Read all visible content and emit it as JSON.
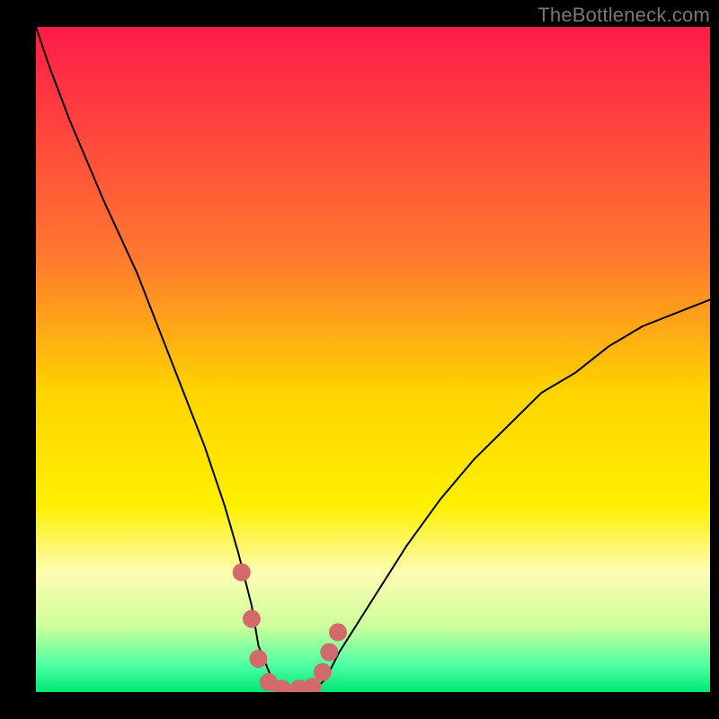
{
  "watermark": "TheBottleneck.com",
  "chart_data": {
    "type": "line",
    "title": "",
    "xlabel": "",
    "ylabel": "",
    "xlim": [
      0,
      100
    ],
    "ylim": [
      0,
      100
    ],
    "gradient_stops": [
      {
        "offset": 0,
        "color": "#ff1b49"
      },
      {
        "offset": 35,
        "color": "#ff7a2e"
      },
      {
        "offset": 55,
        "color": "#ffd400"
      },
      {
        "offset": 72,
        "color": "#fff000"
      },
      {
        "offset": 82,
        "color": "#fdfcb3"
      },
      {
        "offset": 90,
        "color": "#cfff9a"
      },
      {
        "offset": 96,
        "color": "#4dffa4"
      },
      {
        "offset": 100,
        "color": "#00e873"
      }
    ],
    "series": [
      {
        "name": "bottleneck-curve",
        "color": "#000000",
        "stroke_width": 2,
        "x": [
          0,
          2,
          5,
          10,
          15,
          20,
          25,
          28,
          30,
          32,
          33,
          35,
          38,
          41,
          43,
          45,
          50,
          55,
          60,
          65,
          70,
          75,
          80,
          85,
          90,
          95,
          100
        ],
        "y": [
          100,
          94,
          86,
          74,
          63,
          50,
          37,
          28,
          21,
          13,
          7,
          2,
          0,
          0,
          2,
          6,
          14,
          22,
          29,
          35,
          40,
          45,
          48,
          52,
          55,
          57,
          59
        ]
      },
      {
        "name": "marker-dots",
        "color": "#d36a6a",
        "marker_radius": 10,
        "x": [
          30.5,
          32.0,
          33.0,
          34.5,
          36.5,
          39.0,
          41.0,
          42.5,
          43.5,
          44.8
        ],
        "y": [
          18.0,
          11.0,
          5.0,
          1.5,
          0.5,
          0.5,
          0.8,
          3.0,
          6.0,
          9.0
        ]
      }
    ]
  }
}
